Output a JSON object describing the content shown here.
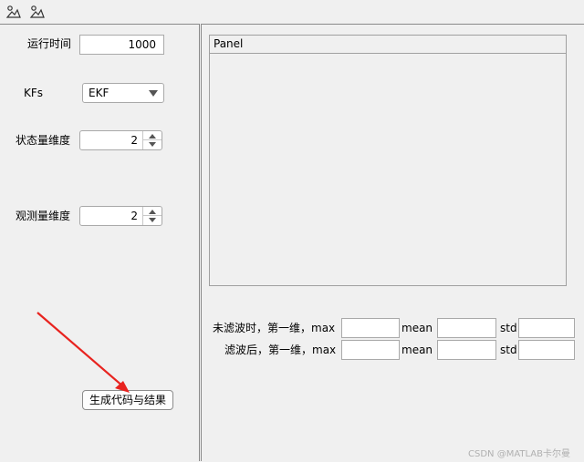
{
  "left": {
    "runtime": {
      "label": "运行时间",
      "value": "1000"
    },
    "kfs": {
      "label": "KFs",
      "value": "EKF"
    },
    "state_dim": {
      "label": "状态量维度",
      "value": "2"
    },
    "obs_dim": {
      "label": "观测量维度",
      "value": "2"
    },
    "generate_button": "生成代码与结果"
  },
  "right": {
    "panel_title": "Panel",
    "stats": [
      {
        "label": "未滤波时，第一维，max",
        "mean_label": "mean",
        "std_label": "std:"
      },
      {
        "label": "滤波后，第一维，max",
        "mean_label": "mean",
        "std_label": "std:"
      }
    ]
  },
  "watermark": "CSDN @MATLAB卡尔曼",
  "colors": {
    "annotation_arrow": "#e8231f"
  }
}
